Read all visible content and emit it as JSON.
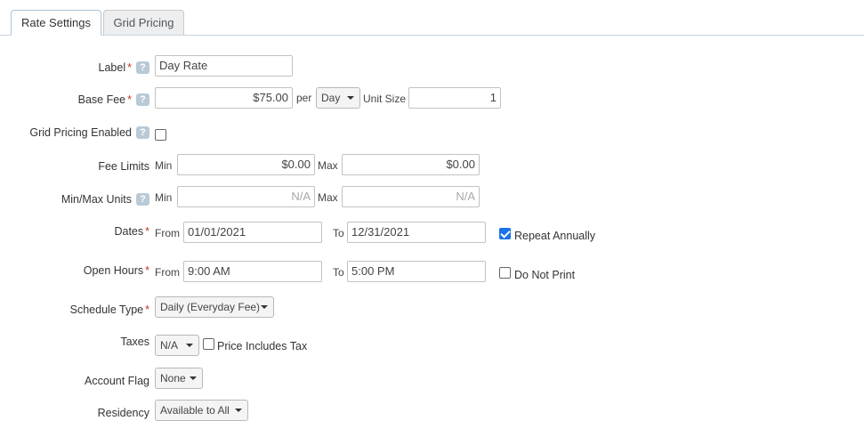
{
  "tabs": [
    {
      "label": "Rate Settings",
      "active": true
    },
    {
      "label": "Grid Pricing",
      "active": false
    }
  ],
  "help_glyph": "?",
  "required_mark": "*",
  "form": {
    "label": {
      "label": "Label",
      "value": "Day Rate"
    },
    "base_fee": {
      "label": "Base Fee",
      "value": "$75.00",
      "per_label": "per",
      "per_unit": "Day",
      "unit_size_label": "Unit Size",
      "unit_size_value": "1"
    },
    "grid_pricing_enabled": {
      "label": "Grid Pricing Enabled",
      "checked": false
    },
    "fee_limits": {
      "label": "Fee Limits",
      "min_label": "Min",
      "min_value": "$0.00",
      "max_label": "Max",
      "max_value": "$0.00"
    },
    "min_max_units": {
      "label": "Min/Max Units",
      "min_label": "Min",
      "min_placeholder": "N/A",
      "max_label": "Max",
      "max_placeholder": "N/A"
    },
    "dates": {
      "label": "Dates",
      "from_label": "From",
      "from_value": "01/01/2021",
      "to_label": "To",
      "to_value": "12/31/2021",
      "repeat_label": "Repeat Annually",
      "repeat_checked": true
    },
    "open_hours": {
      "label": "Open Hours",
      "from_label": "From",
      "from_value": "9:00 AM",
      "to_label": "To",
      "to_value": "5:00 PM",
      "do_not_print_label": "Do Not Print",
      "do_not_print_checked": false
    },
    "schedule_type": {
      "label": "Schedule Type",
      "value": "Daily (Everyday Fee)"
    },
    "taxes": {
      "label": "Taxes",
      "value": "N/A",
      "includes_tax_label": "Price Includes Tax",
      "includes_tax_checked": false
    },
    "account_flag": {
      "label": "Account Flag",
      "value": "None"
    },
    "residency": {
      "label": "Residency",
      "value": "Available to All"
    }
  },
  "colors": {
    "required": "#c0392b",
    "checkbox_checked": "#1a73e8",
    "help_badge": "#b9cad6"
  }
}
